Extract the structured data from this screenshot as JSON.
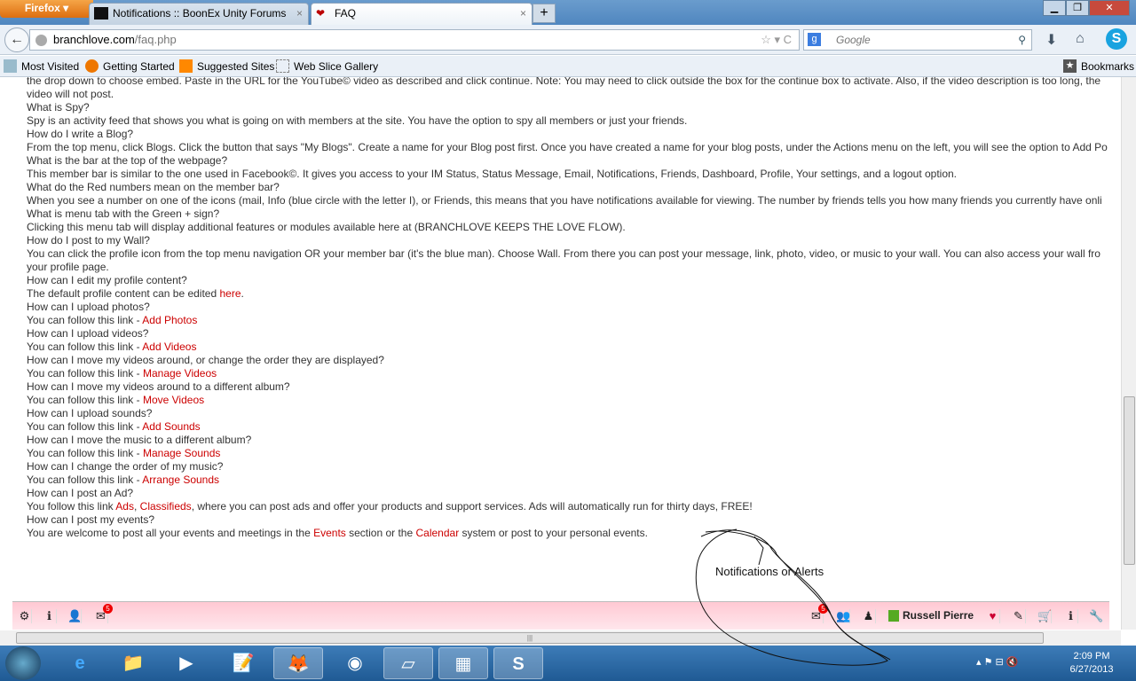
{
  "browser": {
    "menu_button": "Firefox",
    "tabs": [
      {
        "label": "Notifications :: BoonEx Unity Forums"
      },
      {
        "label": "FAQ"
      }
    ],
    "url_host": "branchlove.com",
    "url_path": "/faq.php",
    "search_placeholder": "Google",
    "bookmarks": [
      "Most Visited",
      "Getting Started",
      "Suggested Sites",
      "Web Slice Gallery"
    ],
    "bookmarks_menu": "Bookmarks"
  },
  "faq_lines": [
    [
      {
        "t": "the drop down to choose embed. Paste in the URL for the YouTube© video as described and click continue. Note: You may need to click outside the box for the continue box to activate. Also, if the video description is too long, the"
      }
    ],
    [
      {
        "t": "video will not post."
      }
    ],
    [
      {
        "t": "What is Spy?"
      }
    ],
    [
      {
        "t": "Spy is an activity feed that shows you what is going on with members at the site. You have the option to spy all members or just your friends."
      }
    ],
    [
      {
        "t": "How do I write a Blog?"
      }
    ],
    [
      {
        "t": "From the top menu, click Blogs. Click the button that says \"My Blogs\". Create a name for your Blog post first. Once you have created a name for your blog posts, under the Actions menu on the left, you will see the option to Add Po"
      }
    ],
    [
      {
        "t": "What is the bar at the top of the webpage?"
      }
    ],
    [
      {
        "t": "This member bar is similar to the one used in Facebook©. It gives you access to your IM Status, Status Message, Email, Notifications, Friends, Dashboard, Profile, Your settings, and a logout option."
      }
    ],
    [
      {
        "t": "What do the Red numbers mean on the member bar?"
      }
    ],
    [
      {
        "t": "When you see a number on one of the icons (mail, Info (blue circle with the letter I), or Friends, this means that you have notifications available for viewing. The number by friends tells you how many friends you currently have onli"
      }
    ],
    [
      {
        "t": "What is menu tab with the Green + sign?"
      }
    ],
    [
      {
        "t": "Clicking this menu tab will display additional features or modules available here at (BRANCHLOVE KEEPS THE LOVE FLOW)."
      }
    ],
    [
      {
        "t": "How do I post to my Wall?"
      }
    ],
    [
      {
        "t": "You can click the profile icon from the top menu navigation OR your member bar (it's the blue man). Choose Wall. From there you can post your message, link, photo, video, or music to your wall. You can also access your wall fro"
      }
    ],
    [
      {
        "t": "your profile page."
      }
    ],
    [
      {
        "t": "How can I edit my profile content?"
      }
    ],
    [
      {
        "t": "The default profile content can be edited "
      },
      {
        "t": "here",
        "link": true
      },
      {
        "t": "."
      }
    ],
    [
      {
        "t": "How can I upload photos?"
      }
    ],
    [
      {
        "t": "You can follow this link - "
      },
      {
        "t": "Add Photos",
        "link": true
      }
    ],
    [
      {
        "t": "How can I upload videos?"
      }
    ],
    [
      {
        "t": "You can follow this link - "
      },
      {
        "t": "Add Videos",
        "link": true
      }
    ],
    [
      {
        "t": "How can I move my videos around, or change the order they are displayed?"
      }
    ],
    [
      {
        "t": "You can follow this link - "
      },
      {
        "t": "Manage Videos",
        "link": true
      }
    ],
    [
      {
        "t": "How can I move my videos around to a different album?"
      }
    ],
    [
      {
        "t": "You can follow this link - "
      },
      {
        "t": "Move Videos",
        "link": true
      }
    ],
    [
      {
        "t": "How can I upload sounds?"
      }
    ],
    [
      {
        "t": "You can follow this link - "
      },
      {
        "t": "Add Sounds",
        "link": true
      }
    ],
    [
      {
        "t": "How can I move the music to a different album?"
      }
    ],
    [
      {
        "t": "You can follow this link - "
      },
      {
        "t": "Manage Sounds",
        "link": true
      }
    ],
    [
      {
        "t": "How can I change the order of my music?"
      }
    ],
    [
      {
        "t": "You can follow this link - "
      },
      {
        "t": "Arrange Sounds",
        "link": true
      }
    ],
    [
      {
        "t": "How can I post an Ad?"
      }
    ],
    [
      {
        "t": "You follow this link "
      },
      {
        "t": "Ads",
        "link": true
      },
      {
        "t": ", "
      },
      {
        "t": "Classifieds",
        "link": true
      },
      {
        "t": ", where you can post ads and offer your products and support services. Ads will automatically run for thirty days, FREE!"
      }
    ],
    [
      {
        "t": "How can I post my events?"
      }
    ],
    [
      {
        "t": "You are welcome to post all your events and meetings in the "
      },
      {
        "t": "Events",
        "link": true
      },
      {
        "t": " section or the "
      },
      {
        "t": "Calendar",
        "link": true
      },
      {
        "t": " system or post to your personal events."
      }
    ]
  ],
  "annotation": "Notifications or Alerts",
  "member_bar": {
    "mail_count_left": "5",
    "mail_count_right": "5",
    "user_name": "Russell Pierre"
  },
  "taskbar": {
    "time": "2:09 PM",
    "date": "6/27/2013"
  },
  "colors": {
    "link": "#cc0000",
    "member_bar": "#ffc9d3"
  }
}
